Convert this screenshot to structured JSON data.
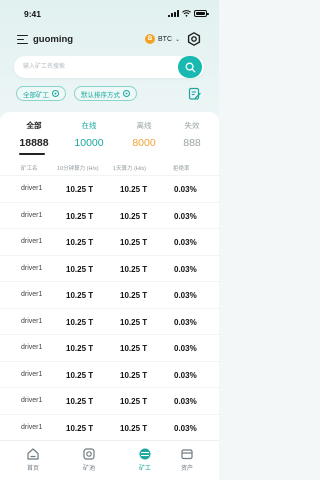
{
  "status_bar": {
    "time": "9:41"
  },
  "header": {
    "username": "guoming",
    "coin": "BTC",
    "coin_symbol": "B"
  },
  "search": {
    "placeholder": "输入矿工名搜索"
  },
  "filters": {
    "group": "全部矿工",
    "sort": "默认排序方式"
  },
  "stats": [
    {
      "label": "全部",
      "value": "18888"
    },
    {
      "label": "在线",
      "value": "10000"
    },
    {
      "label": "离线",
      "value": "8000"
    },
    {
      "label": "失效",
      "value": "888"
    }
  ],
  "table": {
    "headers": {
      "name": "矿工名",
      "hash_10m": "10分钟算力 (H/s)",
      "hash_1d": "1天算力 (H/s)",
      "reject": "拒绝率"
    },
    "rows": [
      {
        "name": "driver1",
        "hash_10m": "10.25 T",
        "hash_1d": "10.25 T",
        "reject": "0.03%"
      },
      {
        "name": "driver1",
        "hash_10m": "10.25 T",
        "hash_1d": "10.25 T",
        "reject": "0.03%"
      },
      {
        "name": "driver1",
        "hash_10m": "10.25 T",
        "hash_1d": "10.25 T",
        "reject": "0.03%"
      },
      {
        "name": "driver1",
        "hash_10m": "10.25 T",
        "hash_1d": "10.25 T",
        "reject": "0.03%"
      },
      {
        "name": "driver1",
        "hash_10m": "10.25 T",
        "hash_1d": "10.25 T",
        "reject": "0.03%"
      },
      {
        "name": "driver1",
        "hash_10m": "10.25 T",
        "hash_1d": "10.25 T",
        "reject": "0.03%"
      },
      {
        "name": "driver1",
        "hash_10m": "10.25 T",
        "hash_1d": "10.25 T",
        "reject": "0.03%"
      },
      {
        "name": "driver1",
        "hash_10m": "10.25 T",
        "hash_1d": "10.25 T",
        "reject": "0.03%"
      },
      {
        "name": "driver1",
        "hash_10m": "10.25 T",
        "hash_1d": "10.25 T",
        "reject": "0.03%"
      },
      {
        "name": "driver1",
        "hash_10m": "10.25 T",
        "hash_1d": "10.25 T",
        "reject": "0.03%"
      }
    ]
  },
  "nav": [
    {
      "label": "首页",
      "icon": "home-icon"
    },
    {
      "label": "矿池",
      "icon": "pool-icon"
    },
    {
      "label": "矿工",
      "icon": "miner-icon"
    },
    {
      "label": "资产",
      "icon": "wallet-icon"
    }
  ],
  "colors": {
    "accent": "#19b9b1",
    "online": "#1aa79f",
    "offline": "#f2a232",
    "invalid": "#9aa3a8",
    "btc": "#f4a223"
  }
}
